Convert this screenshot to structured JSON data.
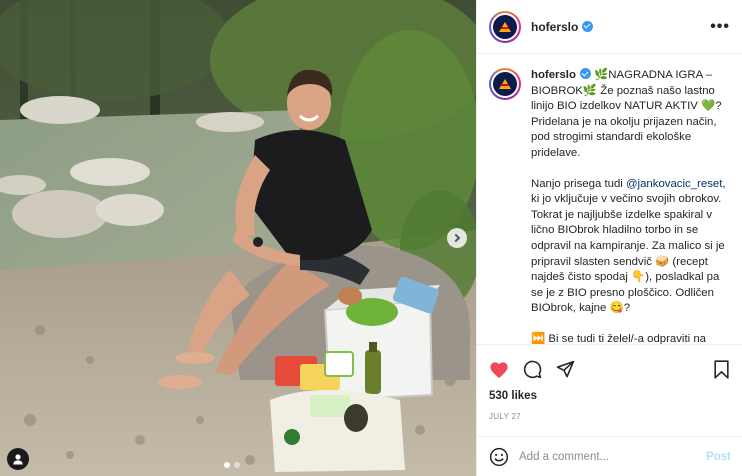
{
  "post": {
    "username": "hoferslo",
    "verified": true,
    "more_label": "•••",
    "caption": {
      "p1_lead": "🌿NAGRADNA IGRA – BIOBROK🌿",
      "p1_rest": "Že poznaš našo lastno linijo BIO izdelkov NATUR AKTIV 💚? Pridelana je na okolju prijazen način, pod strogimi standardi ekološke pridelave.",
      "p2_before": "Nanjo prisega tudi ",
      "p2_mention": "@jankovacic_reset",
      "p2_after": ", ki jo vključuje v večino svojih obrokov. Tokrat je najljubše izdelke spakiral v lično BIObrok hladilno torbo in se odpravil na kampiranje. Za malico si je pripravil slasten sendvič 🥪 (recept najdeš čisto spodaj 👇), posladkal pa se je z BIO presno ploščico. Odličen BIObrok, kajne 😋?",
      "p3": "⏭️ Bi se tudi ti želel/-a odpraviti na izlet s svojo BIObrok hladilno torbo polno izdelkov NATUR AKTIV, ki jih je"
    },
    "likes": "530 likes",
    "date": "JULY 27",
    "comment_placeholder": "Add a comment...",
    "post_button": "Post",
    "colors": {
      "like": "#ed4956",
      "verified": "#3897f0",
      "post_button": "#b2dffc",
      "mention": "#00376b"
    }
  },
  "media": {
    "carousel_dots": 2,
    "active_dot": 0,
    "icons": [
      "chevron-right-icon",
      "tagged-user-icon"
    ]
  }
}
